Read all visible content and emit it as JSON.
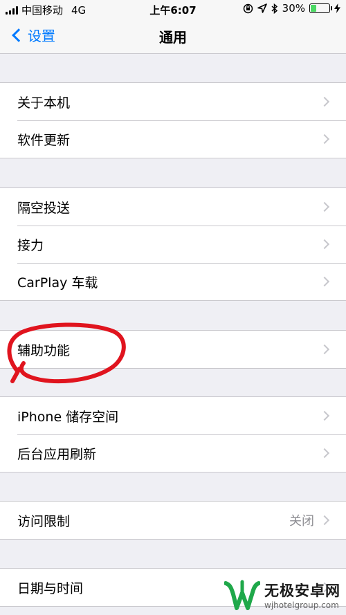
{
  "status": {
    "carrier": "中国移动",
    "network": "4G",
    "time": "上午6:07",
    "battery_text": "30%",
    "battery_level": 0.3
  },
  "nav": {
    "back_label": "设置",
    "title": "通用"
  },
  "groups": [
    {
      "items": [
        {
          "label": "关于本机"
        },
        {
          "label": "软件更新"
        }
      ]
    },
    {
      "items": [
        {
          "label": "隔空投送"
        },
        {
          "label": "接力"
        },
        {
          "label": "CarPlay 车载"
        }
      ]
    },
    {
      "items": [
        {
          "label": "辅助功能"
        }
      ]
    },
    {
      "items": [
        {
          "label": "iPhone 储存空间"
        },
        {
          "label": "后台应用刷新"
        }
      ]
    },
    {
      "items": [
        {
          "label": "访问限制",
          "value": "关闭"
        }
      ]
    },
    {
      "items": [
        {
          "label": "日期与时间"
        }
      ]
    }
  ],
  "watermark": {
    "title": "无极安卓网",
    "url": "wjhotelgroup.com"
  },
  "colors": {
    "accent": "#007aff",
    "annotation": "#e0141e",
    "battery": "#4cd964",
    "watermark_green": "#1fa84a"
  }
}
